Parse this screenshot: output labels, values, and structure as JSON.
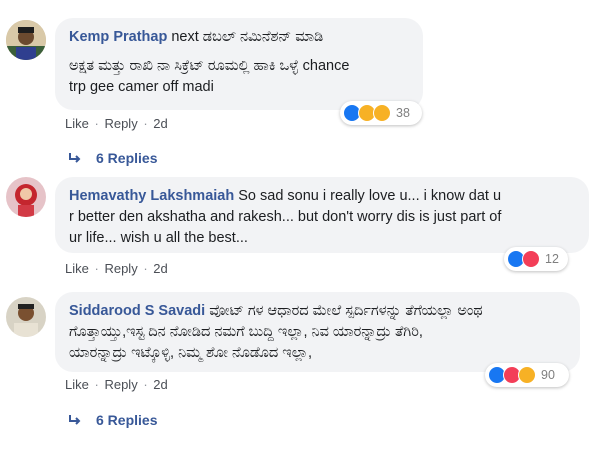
{
  "comments": [
    {
      "author": "Kemp Prathap",
      "first_line_text": "next ಡಬಲ್ ನಮಿನೆಶನ್ ಮಾಡಿ",
      "lines": [
        "ಅಕ್ಷತ ಮತ್ತು ರಾಖಿ ನಾ ಸಿಕ್ರೆಟ್ ರೂಮಲ್ಲಿ ಹಾಕಿ ಒಳ್ಳೆ chance",
        "trp gee camer off madi"
      ],
      "reaction_count": "38",
      "like": "Like",
      "reply": "Reply",
      "time": "2d",
      "replies": "6 Replies"
    },
    {
      "author": "Hemavathy Lakshmaiah",
      "first_line_text": "So sad sonu i really love u... i know dat u",
      "lines": [
        "r better den akshatha and rakesh... but don't worry dis is just part of",
        "ur life... wish u all the best..."
      ],
      "reaction_count": "12",
      "like": "Like",
      "reply": "Reply",
      "time": "2d"
    },
    {
      "author": "Siddarood S Savadi",
      "first_line_text": "ವೋಟ್ ಗಳ ಆಧಾರದ ಮೇಲೆ ಸ್ಪರ್ದಿಗಳನ್ನು ತೆಗೆಯಲ್ಲಾ ಅಂಥ",
      "lines": [
        "ಗೊತ್ತಾಯ್ತು,ಇಸ್ಟ ದಿನ ನೋಡಿದ ನಮಗೆ ಬುದ್ದಿ ಇಲ್ಲಾ, ನಿವ ಯಾರನ್ನಾದ್ರು ತೆಗಿರಿ,",
        "ಯಾರನ್ನಾದ್ರು ಇಟ್ಕೊಳ್ಳಿ, ನಿಮ್ಮ ಶೋ ನೊಡೊದ ಇಲ್ಲಾ,"
      ],
      "reaction_count": "90",
      "like": "Like",
      "reply": "Reply",
      "time": "2d",
      "replies": "6 Replies"
    }
  ],
  "colors": {
    "link": "#385898",
    "bubble": "#f2f3f5",
    "like": "#1877f2",
    "love": "#f33e58",
    "haha": "#f7b125"
  }
}
